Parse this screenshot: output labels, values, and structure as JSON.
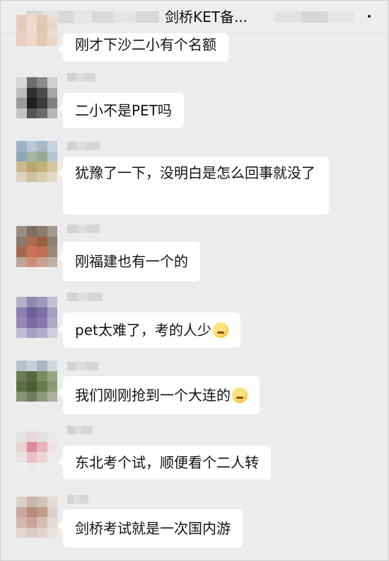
{
  "header": {
    "title": "剑桥KET备..."
  },
  "messages": [
    {
      "text": "刚才下沙二小有个名额"
    },
    {
      "text": "二小不是PET吗"
    },
    {
      "text": "犹豫了一下，没明白是怎么回事就没了"
    },
    {
      "text": "刚福建也有一个的"
    },
    {
      "text": "pet太难了，考的人少",
      "emoji": "thinking-face-icon"
    },
    {
      "text": "我们刚刚抢到一个大连的",
      "emoji": "laughing-tears-face-icon"
    },
    {
      "text": "东北考个试，顺便看个二人转"
    },
    {
      "text": "剑桥考试就是一次国内游"
    }
  ]
}
